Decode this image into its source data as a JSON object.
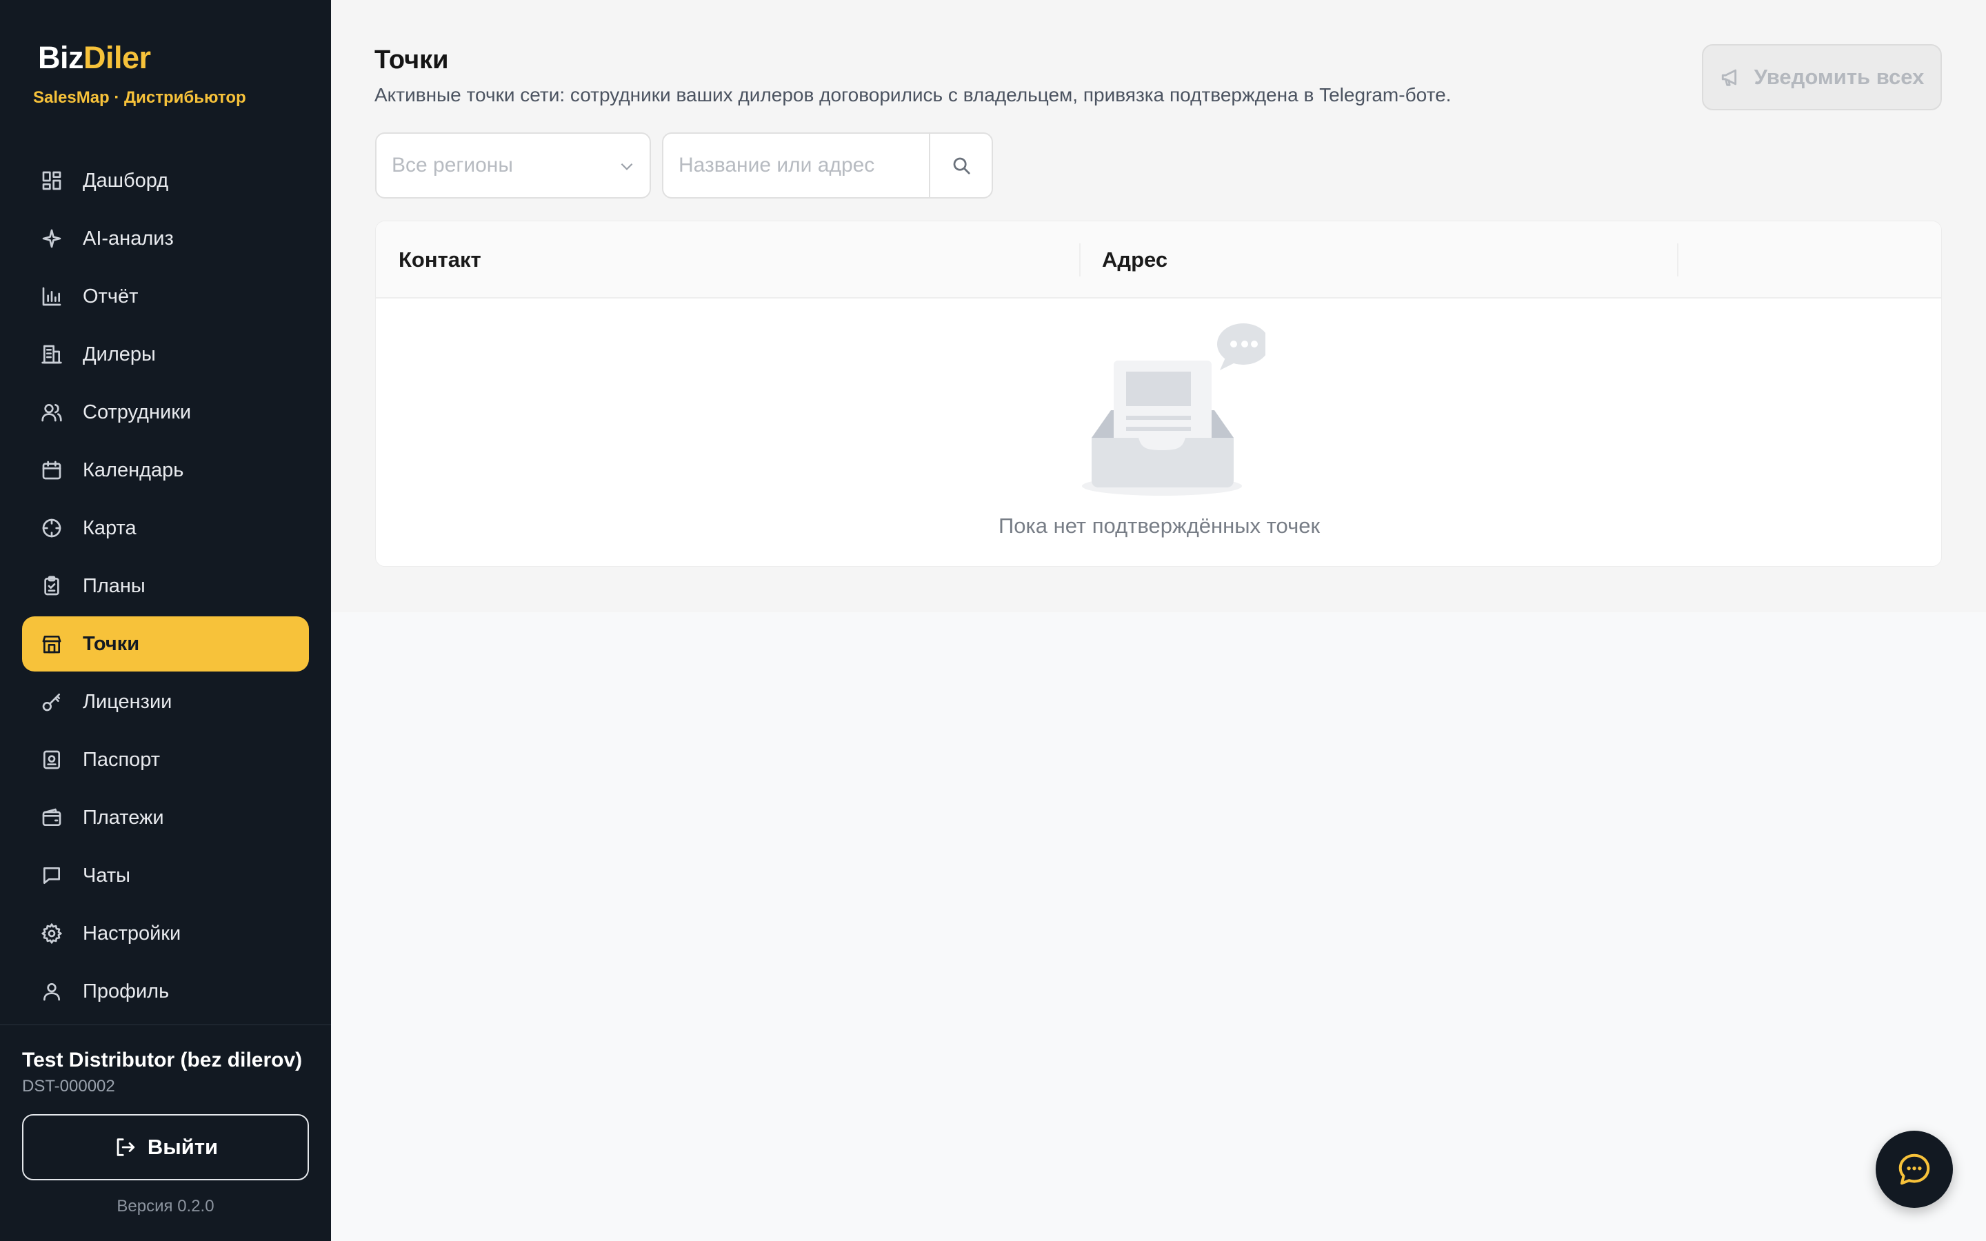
{
  "brand": {
    "name_part1": "Biz",
    "name_part2": "Diler",
    "subtitle": "SalesMap · Дистрибьютор",
    "accent_color": "#f7c23a"
  },
  "sidebar": {
    "items": [
      {
        "label": "Дашборд",
        "icon": "dashboard-icon"
      },
      {
        "label": "AI-анализ",
        "icon": "sparkle-icon"
      },
      {
        "label": "Отчёт",
        "icon": "bar-chart-icon"
      },
      {
        "label": "Дилеры",
        "icon": "building-icon"
      },
      {
        "label": "Сотрудники",
        "icon": "users-icon"
      },
      {
        "label": "Календарь",
        "icon": "calendar-icon"
      },
      {
        "label": "Карта",
        "icon": "crosshair-icon"
      },
      {
        "label": "Планы",
        "icon": "clipboard-icon"
      },
      {
        "label": "Точки",
        "icon": "store-icon",
        "active": true
      },
      {
        "label": "Лицензии",
        "icon": "key-icon"
      },
      {
        "label": "Паспорт",
        "icon": "passport-icon"
      },
      {
        "label": "Платежи",
        "icon": "wallet-icon"
      },
      {
        "label": "Чаты",
        "icon": "chat-icon"
      },
      {
        "label": "Настройки",
        "icon": "gear-icon"
      },
      {
        "label": "Профиль",
        "icon": "user-icon"
      }
    ],
    "account": {
      "name": "Test Distributor (bez dilerov)",
      "id": "DST-000002"
    },
    "logout_label": "Выйти",
    "version": "Версия 0.2.0"
  },
  "main": {
    "title": "Точки",
    "description": "Активные точки сети: сотрудники ваших дилеров договорились с владельцем, привязка подтверждена в Telegram-боте.",
    "notify_button": "Уведомить всех",
    "filters": {
      "region_select": {
        "selected": "Все регионы"
      },
      "search": {
        "placeholder": "Название или адрес",
        "value": ""
      }
    },
    "table": {
      "columns": [
        "Контакт",
        "Адрес",
        ""
      ],
      "rows": [],
      "empty_text": "Пока нет подтверждённых точек"
    }
  },
  "chat_fab": {
    "icon": "chat-bubble-icon"
  }
}
